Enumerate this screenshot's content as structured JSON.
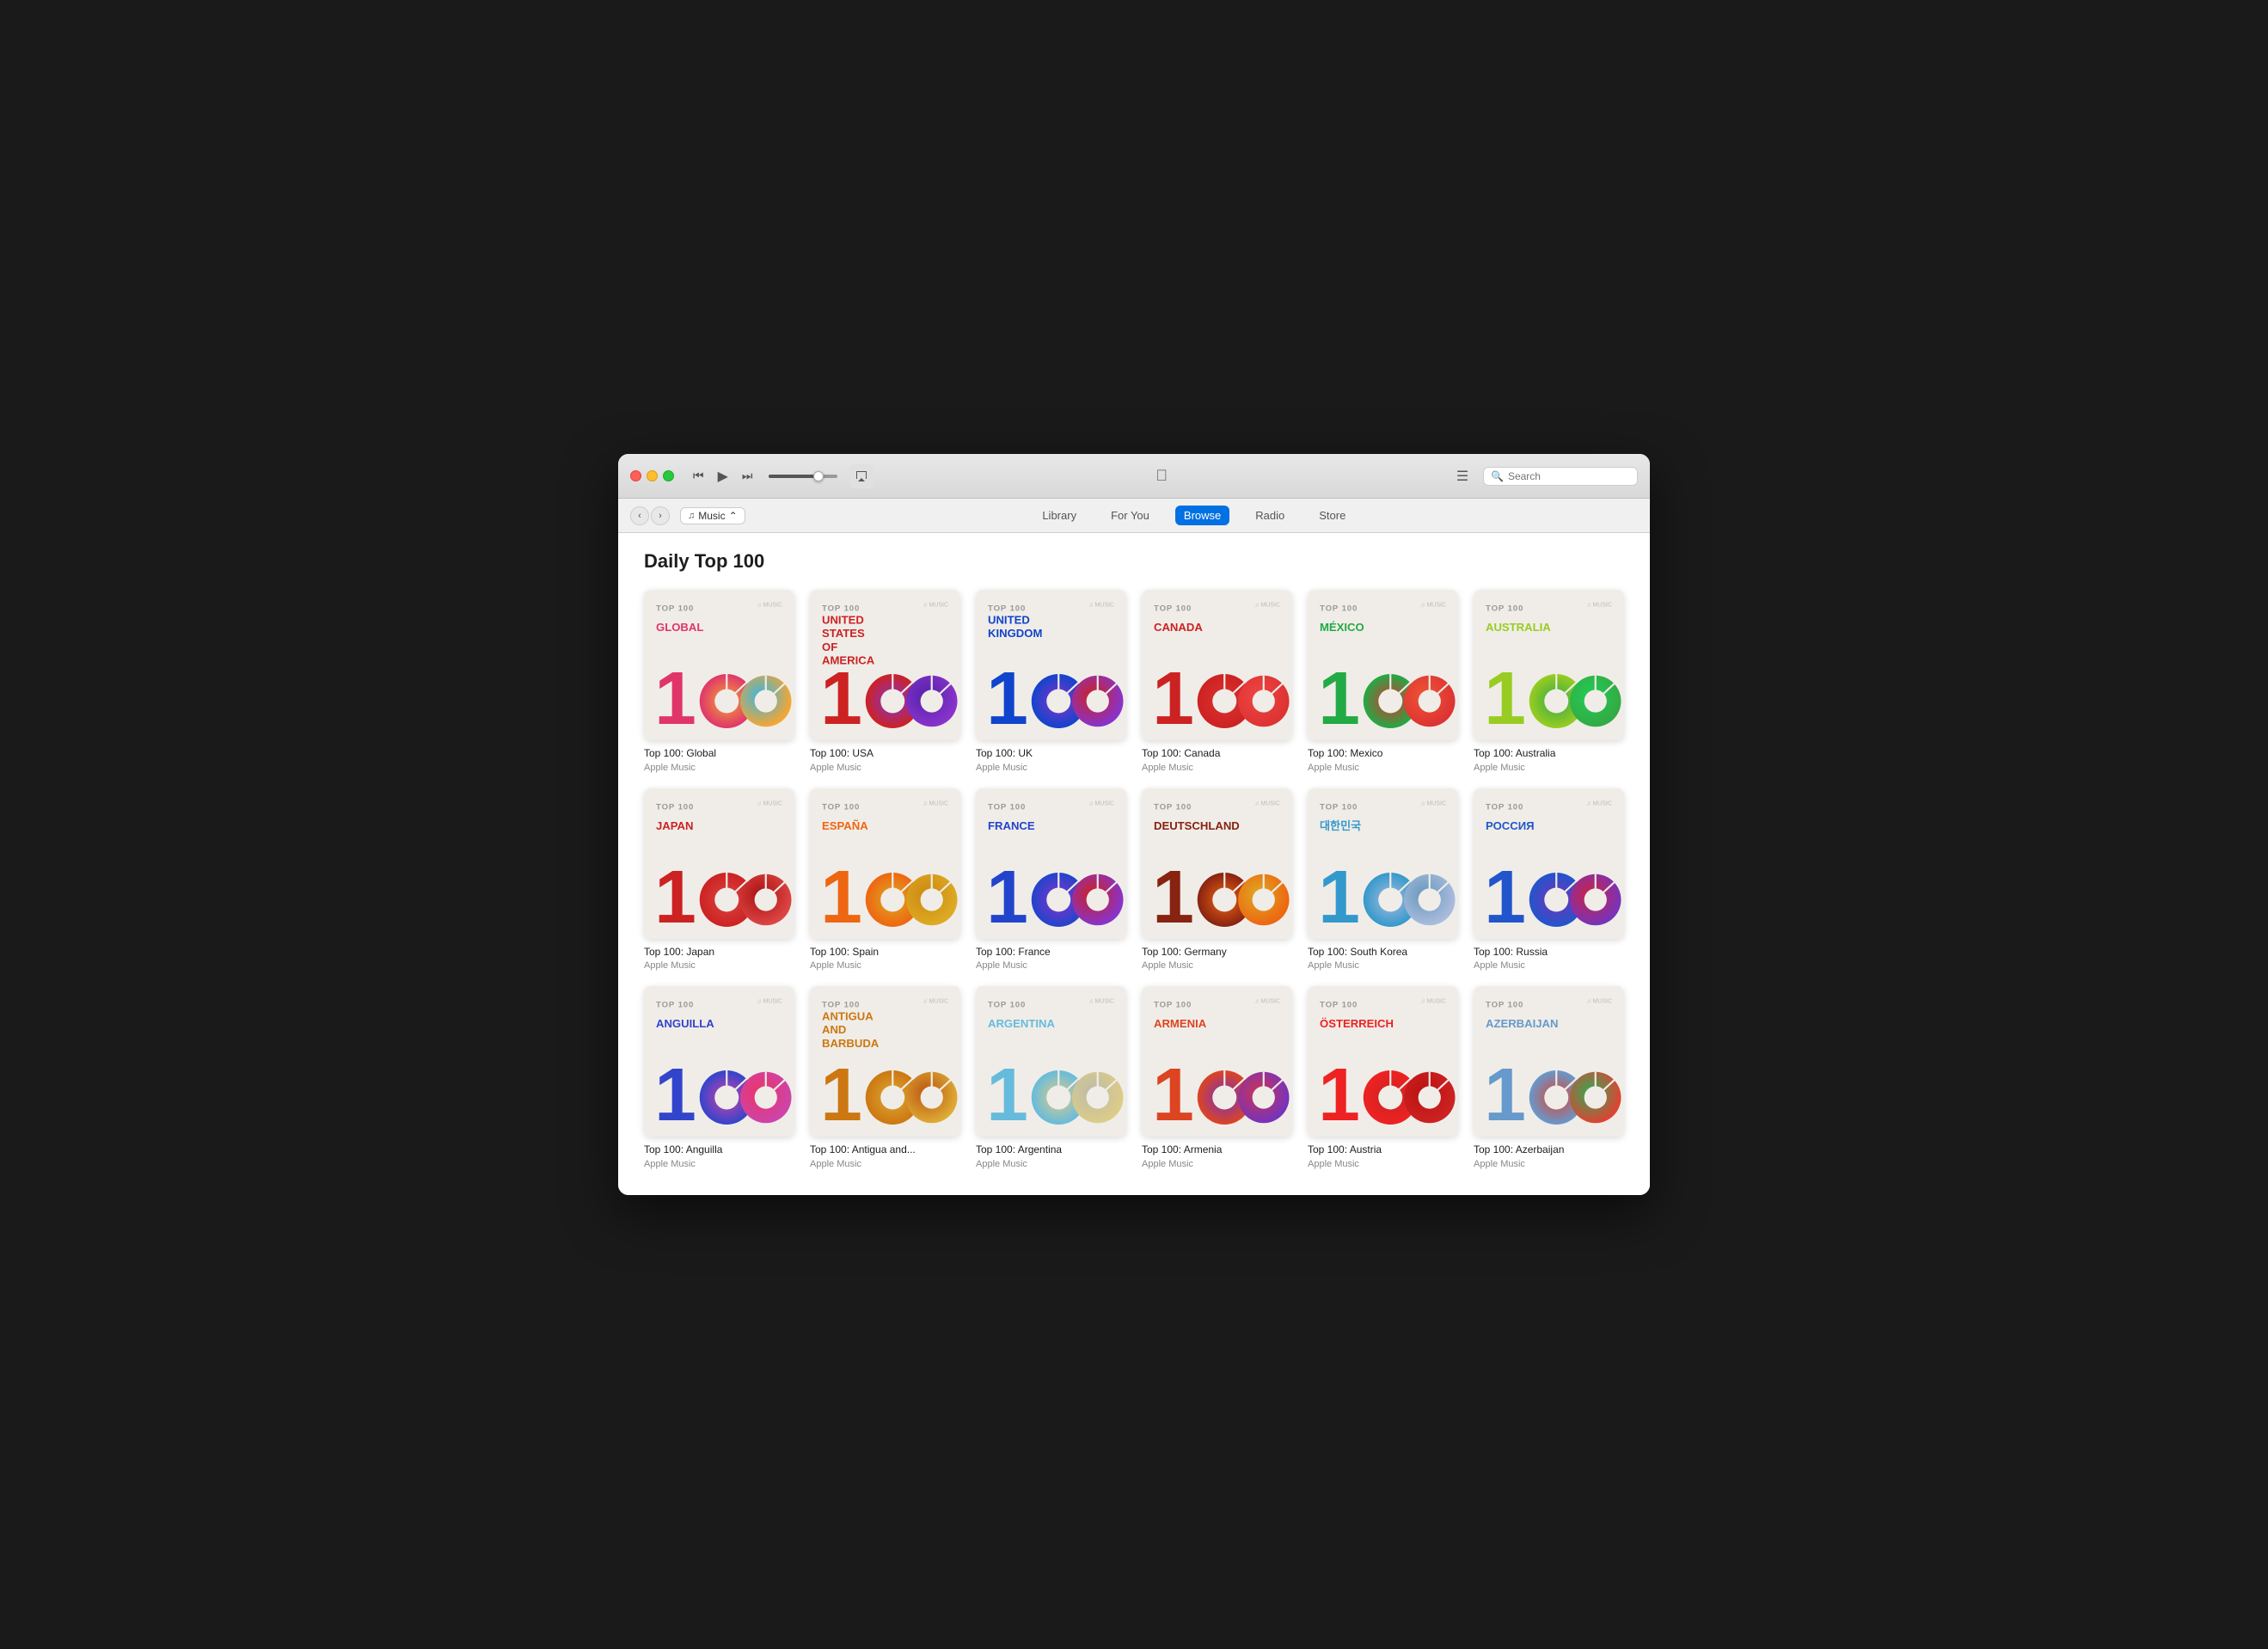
{
  "window": {
    "title": "Apple Music"
  },
  "titlebar": {
    "back_label": "‹",
    "forward_label": "›",
    "rewind_label": "⏮",
    "play_label": "▶",
    "forward_skip_label": "⏭",
    "airplay_label": "⊹",
    "apple_logo": "",
    "list_view_label": "☰",
    "search_placeholder": "Search"
  },
  "navbar": {
    "music_label": "Music",
    "tabs": [
      {
        "id": "library",
        "label": "Library",
        "active": false
      },
      {
        "id": "for-you",
        "label": "For You",
        "active": false
      },
      {
        "id": "browse",
        "label": "Browse",
        "active": true
      },
      {
        "id": "radio",
        "label": "Radio",
        "active": false
      },
      {
        "id": "store",
        "label": "Store",
        "active": false
      }
    ]
  },
  "content": {
    "section_title": "Daily Top 100",
    "apple_music_label": "Apple Music",
    "playlists": [
      {
        "id": "global",
        "name": "Top 100: Global",
        "artist": "Apple Music",
        "country_label": "GLOBAL",
        "label_color": "#e0356b",
        "bg": "#f0ede8",
        "c1": "#e0356b",
        "c2": "#f4a634",
        "c3": "#38b6e0",
        "one_color": "#e0356b"
      },
      {
        "id": "usa",
        "name": "Top 100: USA",
        "artist": "Apple Music",
        "country_label": "UNITED STATES OF AMERICA",
        "label_color": "#cc2222",
        "bg": "#f0ede8",
        "c1": "#cc2222",
        "c2": "#8833cc",
        "c3": "#5522aa",
        "one_color": "#cc2222"
      },
      {
        "id": "uk",
        "name": "Top 100: UK",
        "artist": "Apple Music",
        "country_label": "UNITED KINGDOM",
        "label_color": "#1144cc",
        "bg": "#f0ede8",
        "c1": "#1144cc",
        "c2": "#8833cc",
        "c3": "#cc2222",
        "one_color": "#1144cc"
      },
      {
        "id": "canada",
        "name": "Top 100: Canada",
        "artist": "Apple Music",
        "country_label": "CANADA",
        "label_color": "#cc2222",
        "bg": "#f0ede8",
        "c1": "#cc2222",
        "c2": "#dd3333",
        "c3": "#ee4444",
        "one_color": "#cc2222"
      },
      {
        "id": "mexico",
        "name": "Top 100: Mexico",
        "artist": "Apple Music",
        "country_label": "MÉXICO",
        "label_color": "#22aa44",
        "bg": "#f0ede8",
        "c1": "#22aa44",
        "c2": "#dd3333",
        "c3": "#ee5533",
        "one_color": "#22aa44"
      },
      {
        "id": "australia",
        "name": "Top 100: Australia",
        "artist": "Apple Music",
        "country_label": "AUSTRALIA",
        "label_color": "#99cc22",
        "bg": "#f0ede8",
        "c1": "#99cc22",
        "c2": "#33aa44",
        "c3": "#22cc55",
        "one_color": "#99cc22"
      },
      {
        "id": "japan",
        "name": "Top 100: Japan",
        "artist": "Apple Music",
        "country_label": "JAPAN",
        "label_color": "#cc2222",
        "bg": "#f0ede8",
        "c1": "#cc2222",
        "c2": "#dd4444",
        "c3": "#aa1111",
        "one_color": "#cc2222"
      },
      {
        "id": "spain",
        "name": "Top 100: Spain",
        "artist": "Apple Music",
        "country_label": "ESPAÑA",
        "label_color": "#ee6611",
        "bg": "#f0ede8",
        "c1": "#ee6611",
        "c2": "#ddaa22",
        "c3": "#cc8811",
        "one_color": "#ee6611"
      },
      {
        "id": "france",
        "name": "Top 100: France",
        "artist": "Apple Music",
        "country_label": "FRANCE",
        "label_color": "#2244cc",
        "bg": "#f0ede8",
        "c1": "#2244cc",
        "c2": "#8833cc",
        "c3": "#cc2222",
        "one_color": "#2244cc"
      },
      {
        "id": "germany",
        "name": "Top 100: Germany",
        "artist": "Apple Music",
        "country_label": "DEUTSCHLAND",
        "label_color": "#882211",
        "bg": "#f0ede8",
        "c1": "#882211",
        "c2": "#ee6611",
        "c3": "#ddaa22",
        "one_color": "#882211"
      },
      {
        "id": "south-korea",
        "name": "Top 100: South Korea",
        "artist": "Apple Music",
        "country_label": "대한민국",
        "label_color": "#3399cc",
        "bg": "#f0ede8",
        "c1": "#3399cc",
        "c2": "#aabbdd",
        "c3": "#6699bb",
        "one_color": "#3399cc"
      },
      {
        "id": "russia",
        "name": "Top 100: Russia",
        "artist": "Apple Music",
        "country_label": "РОССИЯ",
        "label_color": "#2255cc",
        "bg": "#f0ede8",
        "c1": "#2255cc",
        "c2": "#7733bb",
        "c3": "#cc2244",
        "one_color": "#2255cc"
      },
      {
        "id": "anguilla",
        "name": "Top 100: Anguilla",
        "artist": "Apple Music",
        "country_label": "ANGUILLA",
        "label_color": "#3344cc",
        "bg": "#f0ede8",
        "c1": "#3344cc",
        "c2": "#cc44aa",
        "c3": "#ee3366",
        "one_color": "#3344cc"
      },
      {
        "id": "antigua",
        "name": "Top 100: Antigua and...",
        "artist": "Apple Music",
        "country_label": "ANTIGUA AND BARBUDA",
        "label_color": "#cc7711",
        "bg": "#f0ede8",
        "c1": "#cc7711",
        "c2": "#ddaa33",
        "c3": "#bb5511",
        "one_color": "#cc7711"
      },
      {
        "id": "argentina",
        "name": "Top 100: Argentina",
        "artist": "Apple Music",
        "country_label": "ARGENTINA",
        "label_color": "#66bbdd",
        "bg": "#f0ede8",
        "c1": "#66bbdd",
        "c2": "#ddcc88",
        "c3": "#bbbbaa",
        "one_color": "#66bbdd"
      },
      {
        "id": "armenia",
        "name": "Top 100: Armenia",
        "artist": "Apple Music",
        "country_label": "ARMENIA",
        "label_color": "#dd4422",
        "bg": "#f0ede8",
        "c1": "#dd4422",
        "c2": "#7733bb",
        "c3": "#cc3355",
        "one_color": "#dd4422"
      },
      {
        "id": "austria",
        "name": "Top 100: Austria",
        "artist": "Apple Music",
        "country_label": "ÖSTERREICH",
        "label_color": "#ee2222",
        "bg": "#f0ede8",
        "c1": "#ee2222",
        "c2": "#cc2222",
        "c3": "#bb1111",
        "one_color": "#ee2222"
      },
      {
        "id": "azerbaijan",
        "name": "Top 100: Azerbaijan",
        "artist": "Apple Music",
        "country_label": "AZERBAIJAN",
        "label_color": "#6699cc",
        "bg": "#f0ede8",
        "c1": "#6699cc",
        "c2": "#dd4433",
        "c3": "#33aa55",
        "one_color": "#6699cc"
      }
    ]
  }
}
